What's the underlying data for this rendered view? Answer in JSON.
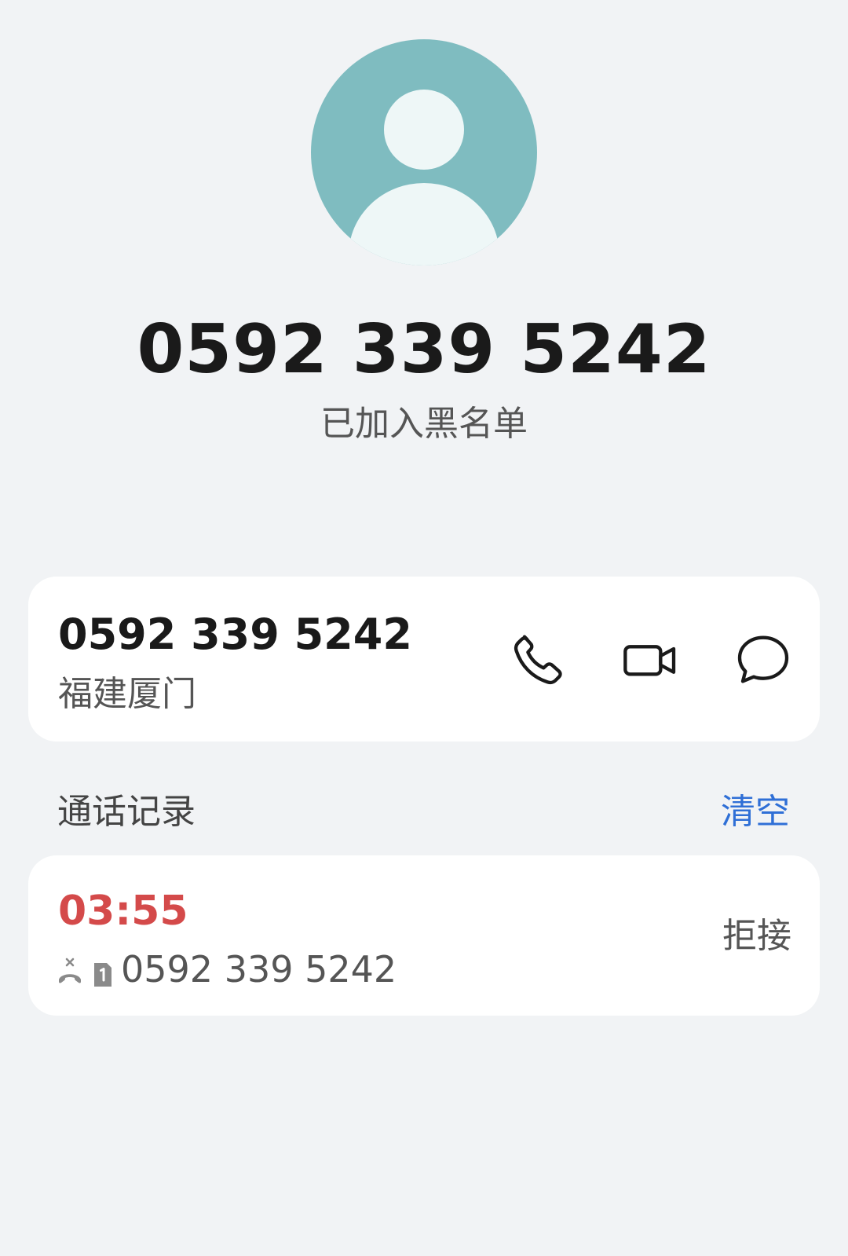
{
  "contact": {
    "number_title": "0592 339 5242",
    "status": "已加入黑名单",
    "number": "0592 339 5242",
    "location": "福建厦门"
  },
  "actions": {
    "call_icon": "phone-icon",
    "video_icon": "video-camera-icon",
    "message_icon": "message-bubble-icon"
  },
  "call_history": {
    "header": "通话记录",
    "clear_label": "清空",
    "entries": [
      {
        "time": "03:55",
        "number": "0592 339 5242",
        "status": "拒接",
        "call_type_icon": "rejected-call-icon",
        "sim_icon": "sim-1-icon"
      }
    ]
  },
  "colors": {
    "background": "#f1f3f5",
    "avatar": "#7fbcc0",
    "missed_time": "#d44a4a",
    "accent": "#2f6fd6"
  }
}
